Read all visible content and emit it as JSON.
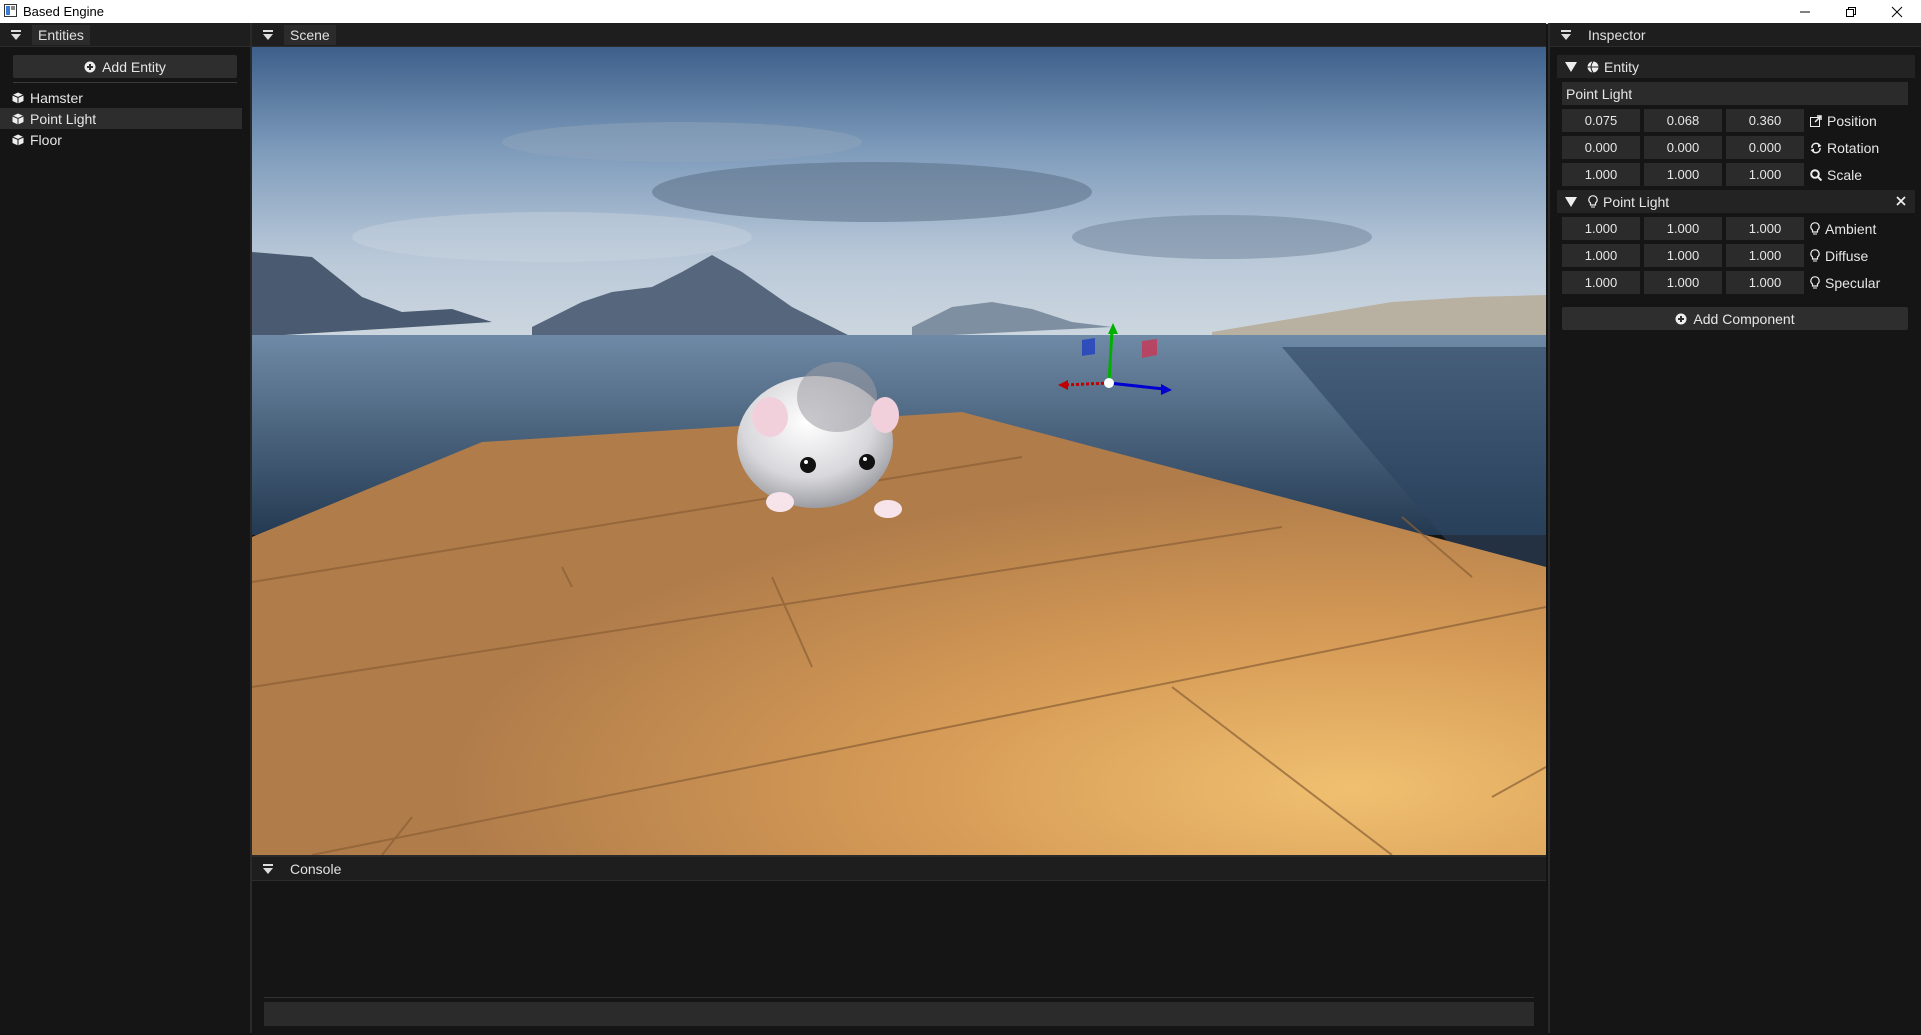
{
  "window": {
    "title": "Based Engine",
    "controls": [
      "minimize-icon",
      "restore-icon",
      "close-icon"
    ]
  },
  "entities_panel": {
    "tab_label": "Entities",
    "add_entity_label": "Add Entity",
    "items": [
      {
        "label": "Hamster",
        "selected": false
      },
      {
        "label": "Point Light",
        "selected": true
      },
      {
        "label": "Floor",
        "selected": false
      }
    ]
  },
  "scene_panel": {
    "tab_label": "Scene"
  },
  "console_panel": {
    "tab_label": "Console",
    "input_value": ""
  },
  "inspector_panel": {
    "tab_label": "Inspector",
    "entity_section": {
      "header": "Entity",
      "name_value": "Point Light",
      "position": {
        "label": "Position",
        "values": [
          "0.075",
          "0.068",
          "0.360"
        ]
      },
      "rotation": {
        "label": "Rotation",
        "values": [
          "0.000",
          "0.000",
          "0.000"
        ]
      },
      "scale": {
        "label": "Scale",
        "values": [
          "1.000",
          "1.000",
          "1.000"
        ]
      }
    },
    "point_light_section": {
      "header": "Point Light",
      "ambient": {
        "label": "Ambient",
        "values": [
          "1.000",
          "1.000",
          "1.000"
        ]
      },
      "diffuse": {
        "label": "Diffuse",
        "values": [
          "1.000",
          "1.000",
          "1.000"
        ]
      },
      "specular": {
        "label": "Specular",
        "values": [
          "1.000",
          "1.000",
          "1.000"
        ]
      }
    },
    "add_component_label": "Add Component"
  },
  "colors": {
    "panel_bg": "#151515",
    "header_bg": "#1e1e1e",
    "field_bg": "#2b2b2b",
    "gizmo_x": "#c00000",
    "gizmo_y": "#00b000",
    "gizmo_z": "#0000d0"
  }
}
